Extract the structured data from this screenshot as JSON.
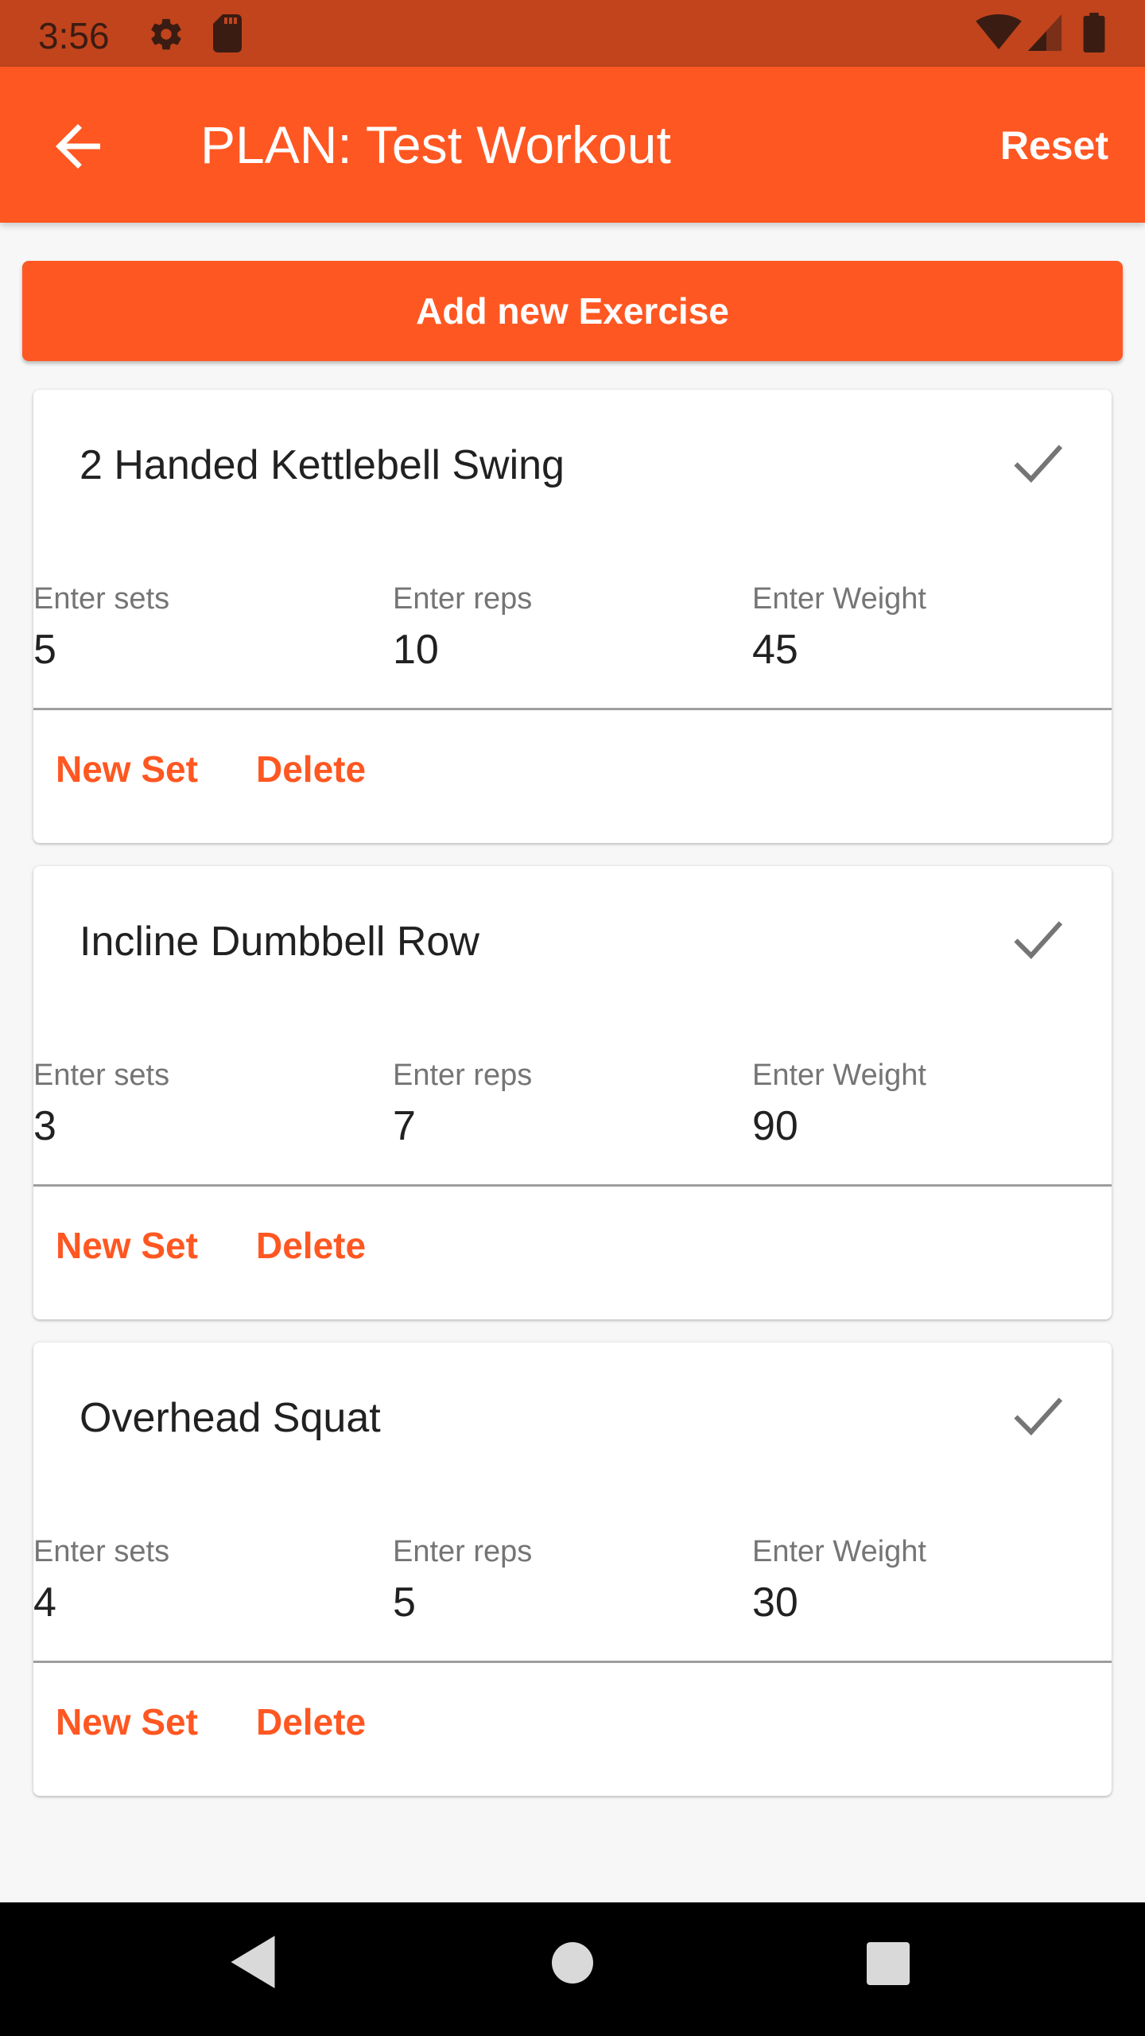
{
  "status_bar": {
    "time": "3:56",
    "icons": [
      "settings-icon",
      "sd-card-icon",
      "wifi-icon",
      "signal-icon",
      "battery-icon"
    ]
  },
  "app_bar": {
    "title": "PLAN: Test Workout",
    "back_icon": "arrow-back-icon",
    "reset_label": "Reset"
  },
  "add_exercise_label": "Add new Exercise",
  "exercises": [
    {
      "name": "2 Handed Kettlebell Swing",
      "sets_label": "Enter sets",
      "sets": "5",
      "reps_label": "Enter reps",
      "reps": "10",
      "weight_label": "Enter Weight",
      "weight": "45",
      "new_set_label": "New Set",
      "delete_label": "Delete"
    },
    {
      "name": "Incline Dumbbell Row",
      "sets_label": "Enter sets",
      "sets": "3",
      "reps_label": "Enter reps",
      "reps": "7",
      "weight_label": "Enter Weight",
      "weight": "90",
      "new_set_label": "New Set",
      "delete_label": "Delete"
    },
    {
      "name": "Overhead Squat",
      "sets_label": "Enter sets",
      "sets": "4",
      "reps_label": "Enter reps",
      "reps": "5",
      "weight_label": "Enter Weight",
      "weight": "30",
      "new_set_label": "New Set",
      "delete_label": "Delete"
    }
  ],
  "nav_bar": {
    "icons": [
      "nav-back-icon",
      "nav-home-icon",
      "nav-recents-icon"
    ]
  },
  "colors": {
    "accent": "#ff5722",
    "status_bar": "#c1441d",
    "background": "#f7f7f7"
  }
}
